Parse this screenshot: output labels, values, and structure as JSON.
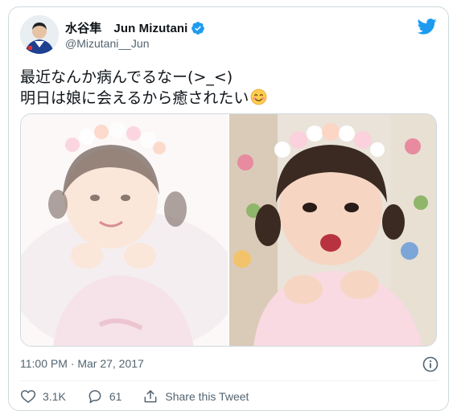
{
  "tweet": {
    "author": {
      "display_name": "水谷隼　Jun Mizutani",
      "handle": "@Mizutani__Jun"
    },
    "text_lines": [
      "最近なんか病んでるなー(>_<)",
      "明日は娘に会えるから癒されたい"
    ],
    "timestamp": "11:00 PM · Mar 27, 2017"
  },
  "actions": {
    "likes": "3.1K",
    "replies": "61",
    "share_label": "Share this Tweet"
  },
  "icons": {
    "brand": "twitter-bird-icon",
    "verified": "verified-badge-icon",
    "emoji": "smiling-face-emoji",
    "info": "info-icon",
    "like": "heart-icon",
    "reply": "speech-bubble-icon",
    "share": "share-upload-icon"
  },
  "colors": {
    "brand_blue": "#1d9bf0",
    "text_primary": "#0f1419",
    "text_secondary": "#536471",
    "border": "#cfd9de"
  }
}
